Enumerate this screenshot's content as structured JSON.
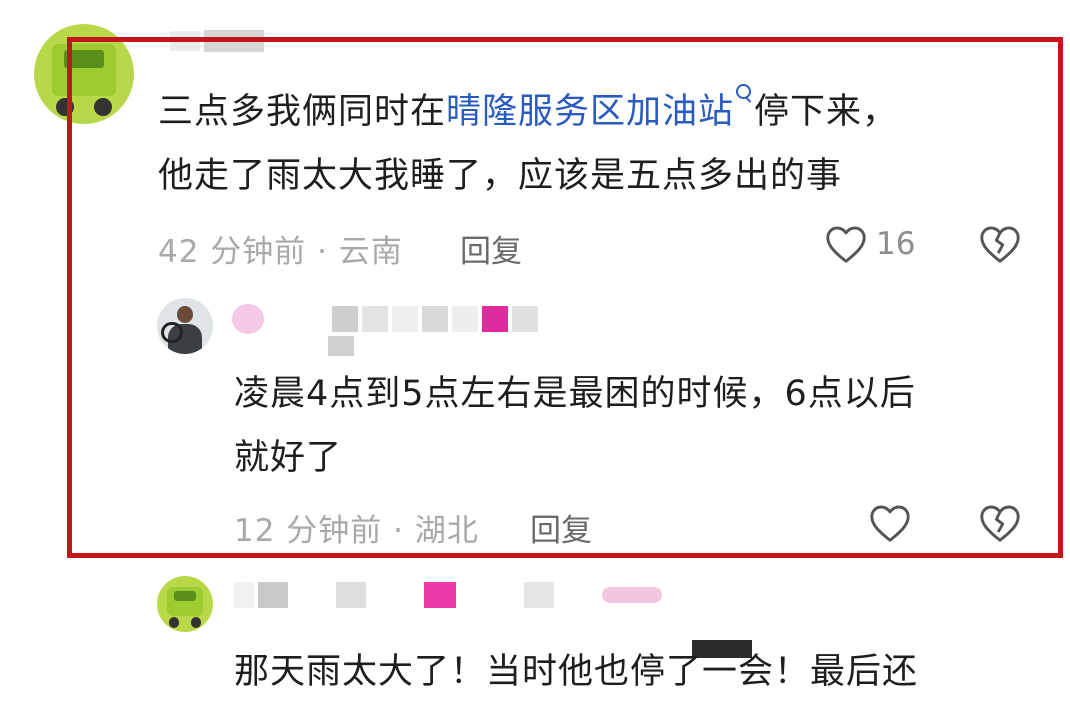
{
  "comments": [
    {
      "text_plain_1": "三点多我俩同时在",
      "text_link": "晴隆服务区加油站",
      "text_plain_2": "停下来，",
      "text_line2": "他走了雨太大我睡了，应该是五点多出的事",
      "time_location": "42 分钟前 · 云南",
      "reply_label": "回复",
      "like_count": "16",
      "reply": {
        "text_line1": "凌晨4点到5点左右是最困的时候，6点以后",
        "text_line2": "就好了",
        "time_location": "12 分钟前 · 湖北",
        "reply_label": "回复"
      }
    },
    {
      "text_line1": "那天雨太大了！当时他也停了一会！最后还"
    }
  ],
  "colors": {
    "highlight_border": "#c4151b",
    "link": "#2a5bbf",
    "meta": "#a9a9a9"
  },
  "icons": [
    "heart-outline-icon",
    "broken-heart-icon",
    "search-icon"
  ]
}
